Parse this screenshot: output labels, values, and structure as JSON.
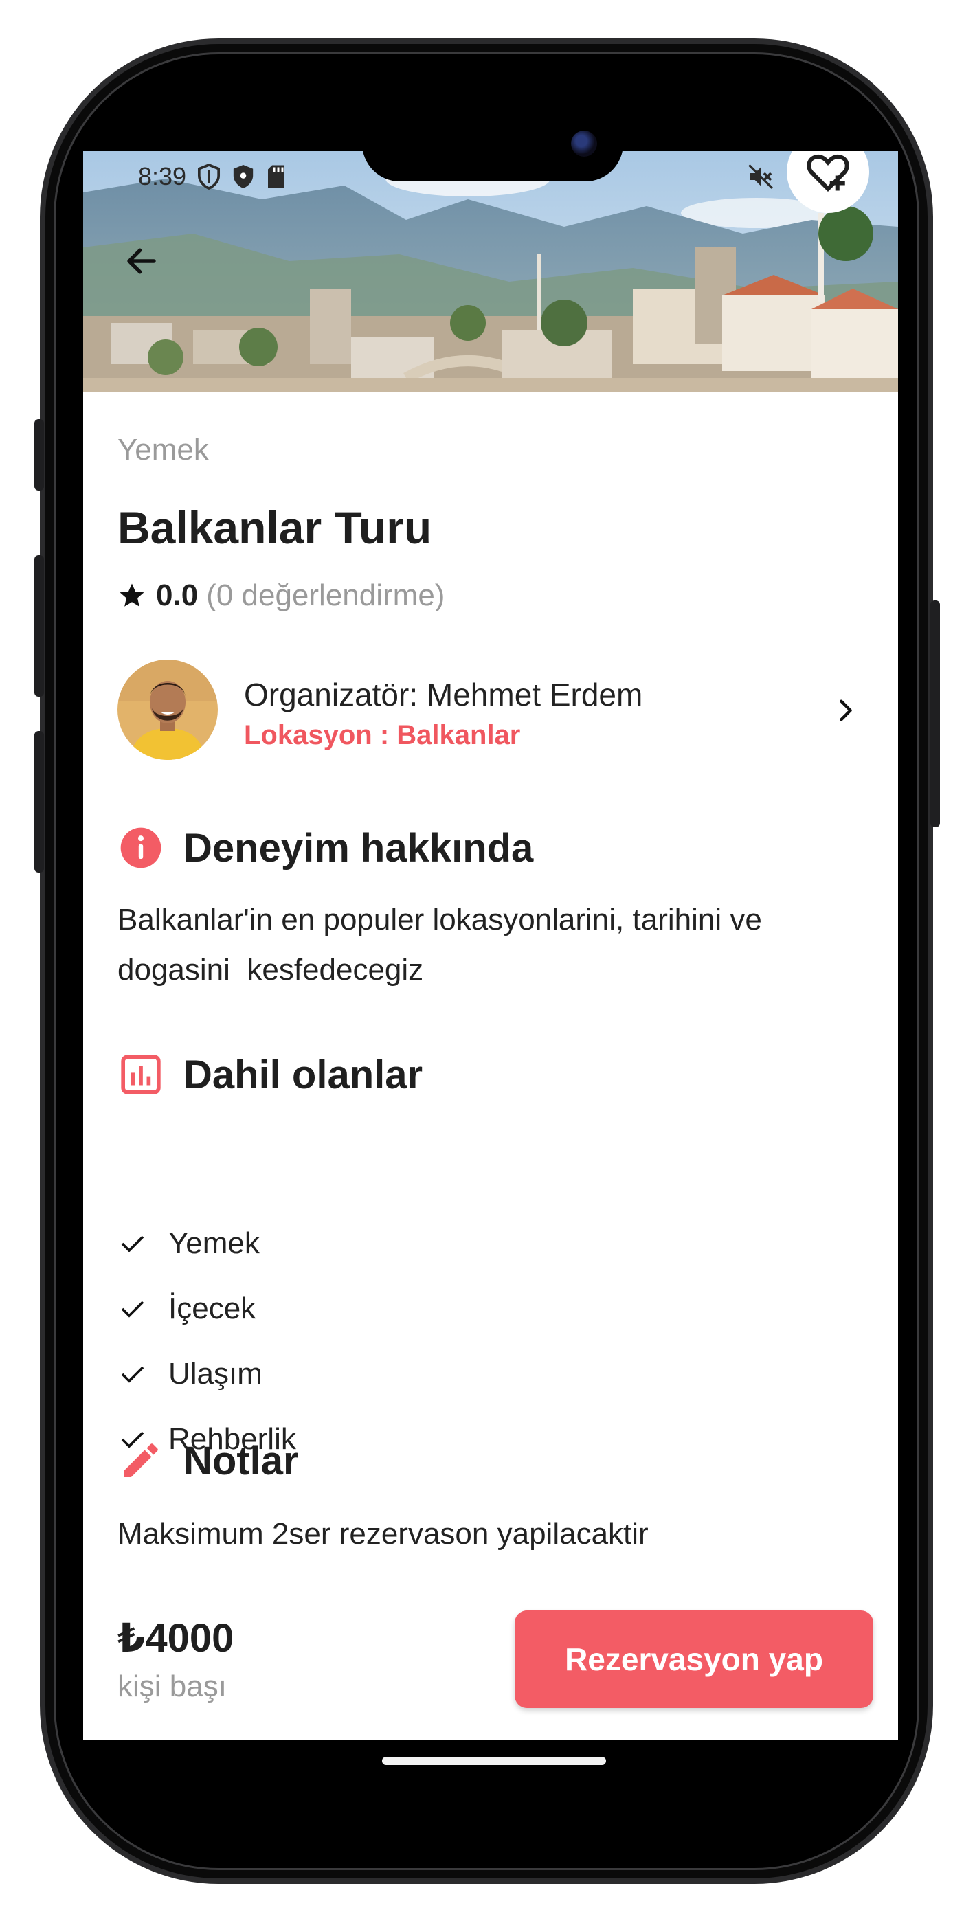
{
  "status_bar": {
    "time": "8:39",
    "left_icons": [
      "vpn-shield-icon",
      "shield-icon",
      "sd-card-icon"
    ],
    "right_icons": [
      "mute-icon",
      "wifi-icon",
      "signal-icon"
    ]
  },
  "hero": {
    "back_icon": "arrow-back-icon",
    "favorite_icon": "heart-add-icon"
  },
  "experience": {
    "category": "Yemek",
    "title": "Balkanlar Turu",
    "rating_score": "0.0",
    "rating_count": "(0 değerlendirme)"
  },
  "organizer": {
    "name": "Organizatör: Mehmet Erdem",
    "location": "Lokasyon : Balkanlar"
  },
  "about": {
    "heading": "Deneyim hakkında",
    "line1": "Balkanlar'in en populer lokasyonlarini, tarihini ve",
    "line2": "dogasini  kesfedecegiz"
  },
  "included": {
    "heading": "Dahil olanlar",
    "items": [
      "Yemek",
      "İçecek",
      "Ulaşım",
      "Rehberlik"
    ]
  },
  "notes": {
    "heading": "Notlar",
    "text": "Maksimum 2ser rezervason yapilacaktir"
  },
  "footer": {
    "price": "₺4000",
    "per": "kişi başı",
    "book_label": "Rezervasyon yap"
  },
  "colors": {
    "accent": "#f35c65",
    "accent_text": "#f0575f",
    "muted": "#9a9a9a"
  }
}
